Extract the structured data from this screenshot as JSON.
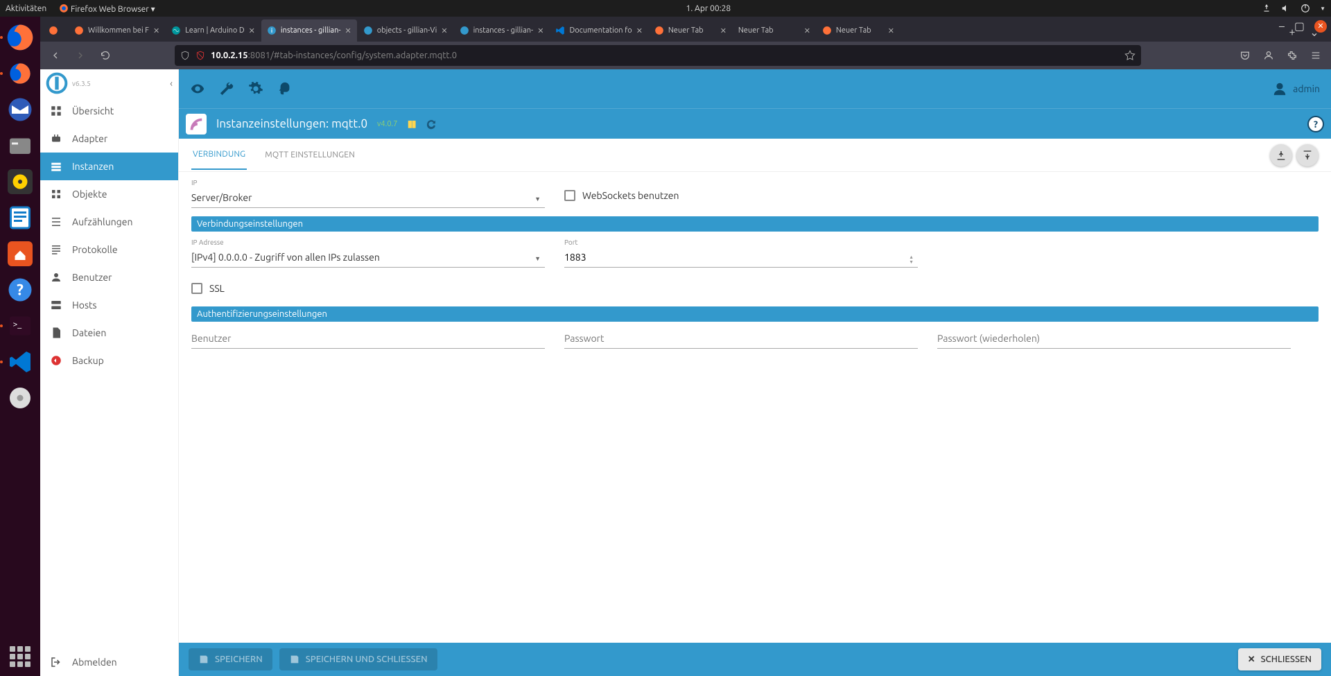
{
  "gnome": {
    "activities": "Aktivitäten",
    "app_menu": "Firefox Web Browser",
    "datetime": "1. Apr  00:28"
  },
  "tabs": [
    {
      "title": "Willkommen bei F",
      "active": false
    },
    {
      "title": "Learn | Arduino D",
      "active": false
    },
    {
      "title": "instances - gillian-",
      "active": true
    },
    {
      "title": "objects - gillian-Vi",
      "active": false
    },
    {
      "title": "instances - gillian-",
      "active": false
    },
    {
      "title": "Documentation fo",
      "active": false
    },
    {
      "title": "Neuer Tab",
      "active": false
    },
    {
      "title": "Neuer Tab",
      "active": false
    },
    {
      "title": "Neuer Tab",
      "active": false
    }
  ],
  "url": {
    "host": "10.0.2.15",
    "rest": ":8081/#tab-instances/config/system.adapter.mqtt.0"
  },
  "iob": {
    "version": "v6.3.5",
    "nav": {
      "uebersicht": "Übersicht",
      "adapter": "Adapter",
      "instanzen": "Instanzen",
      "objekte": "Objekte",
      "aufzaehlungen": "Aufzählungen",
      "protokolle": "Protokolle",
      "benutzer": "Benutzer",
      "hosts": "Hosts",
      "dateien": "Dateien",
      "backup": "Backup",
      "abmelden": "Abmelden"
    },
    "user": "admin",
    "instance_title": "Instanzeinstellungen: mqtt.0",
    "instance_ver": "v4.0.7",
    "config_tabs": {
      "verbindung": "VERBINDUNG",
      "mqtt": "MQTT EINSTELLUNGEN"
    },
    "form": {
      "ip_label": "IP",
      "ip_value": "Server/Broker",
      "websockets_label": "WebSockets benutzen",
      "section_conn": "Verbindungseinstellungen",
      "ipaddr_label": "IP Adresse",
      "ipaddr_value": "[IPv4] 0.0.0.0 - Zugriff von allen IPs zulassen",
      "port_label": "Port",
      "port_value": "1883",
      "ssl_label": "SSL",
      "section_auth": "Authentifizierungseinstellungen",
      "user_placeholder": "Benutzer",
      "pass_placeholder": "Passwort",
      "pass2_placeholder": "Passwort (wiederholen)"
    },
    "footer": {
      "save": "SPEICHERN",
      "save_close": "SPEICHERN UND SCHLIESSEN",
      "close": "SCHLIESSEN"
    }
  }
}
